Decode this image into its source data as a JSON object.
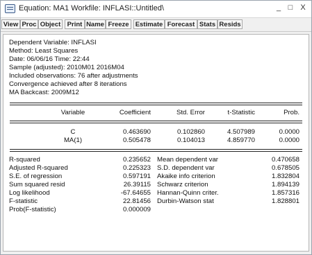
{
  "window": {
    "title": "Equation: MA1   Workfile: INFLASI::Untitled\\",
    "minimize_glyph": "_",
    "maximize_glyph": "□",
    "close_glyph": "X"
  },
  "toolbar": {
    "buttons": [
      "View",
      "Proc",
      "Object",
      "Print",
      "Name",
      "Freeze",
      "Estimate",
      "Forecast",
      "Stats",
      "Resids"
    ]
  },
  "header": {
    "lines": [
      "Dependent Variable: INFLASI",
      "Method: Least Squares",
      "Date: 06/06/16   Time: 22:44",
      "Sample (adjusted): 2010M01 2016M04",
      "Included observations: 76 after adjustments",
      "Convergence achieved after 8 iterations",
      "MA Backcast: 2009M12"
    ]
  },
  "coef_table": {
    "columns": [
      "Variable",
      "Coefficient",
      "Std. Error",
      "t-Statistic",
      "Prob."
    ],
    "rows": [
      [
        "C",
        "0.463690",
        "0.102860",
        "4.507989",
        "0.0000"
      ],
      [
        "MA(1)",
        "0.505478",
        "0.104013",
        "4.859770",
        "0.0000"
      ]
    ]
  },
  "stats": {
    "left": [
      [
        "R-squared",
        "0.235652"
      ],
      [
        "Adjusted R-squared",
        "0.225323"
      ],
      [
        "S.E. of regression",
        "0.597191"
      ],
      [
        "Sum squared resid",
        "26.39115"
      ],
      [
        "Log likelihood",
        "-67.64655"
      ],
      [
        "F-statistic",
        "22.81456"
      ],
      [
        "Prob(F-statistic)",
        "0.000009"
      ]
    ],
    "right": [
      [
        "Mean dependent var",
        "0.470658"
      ],
      [
        "S.D. dependent var",
        "0.678505"
      ],
      [
        "Akaike info criterion",
        "1.832804"
      ],
      [
        "Schwarz criterion",
        "1.894139"
      ],
      [
        "Hannan-Quinn criter.",
        "1.857316"
      ],
      [
        "Durbin-Watson stat",
        "1.828801"
      ]
    ]
  }
}
